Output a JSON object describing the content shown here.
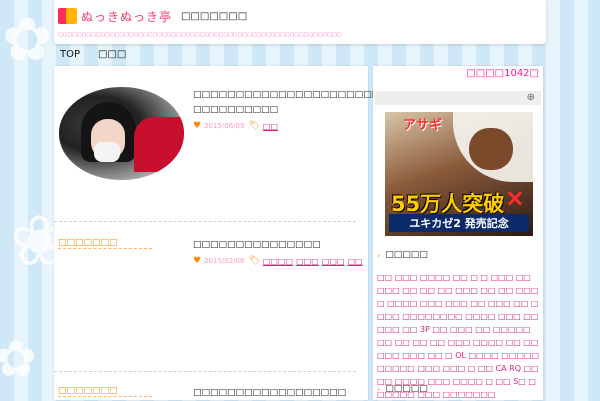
{
  "header": {
    "logo_text": "ぬっきぬっき亭",
    "site_title": "□□□□□□□",
    "tagline": "□□□□□□□□□□□□□□□□□□□□□□□□□□□□□□□□□□□□□□□□□□□□□□□□□□□□□□□□□□□□"
  },
  "nav": {
    "items": [
      "TOP",
      "□□□"
    ]
  },
  "posts": [
    {
      "title": "□□□□□□□□□□□□□□□□□□□□□□□□□□□□□□…□□□□□□□□□□",
      "date": "2015/06/09",
      "tags": [
        "□□"
      ]
    },
    {
      "category": "□□□□□□□",
      "title": "□□□□□□□□□□□□□□□",
      "date": "2015/02/06",
      "tags": [
        "□□□□",
        "□□□",
        "□□□",
        "□□"
      ]
    },
    {
      "category": "□□□□□□□",
      "title": "□□□□□□□□□□□□□□□□□□"
    }
  ],
  "sidebar": {
    "counter": "□□□□1042□",
    "banner": {
      "brand": "アサギ",
      "number": "55万人突破",
      "cross": "×",
      "subtitle": "ユキカゼ2 発売記念"
    },
    "tags_heading": "□□□□□",
    "tag_cloud": "□□ □□□ □□□□ □□ □ □ □□□ □□ □□□ □□ □□ □□ □□□ □□ □□ □□□□ □□□□ □□□ □□□ □□ □□□ □□ □□□□ □□□□□□□□ □□□□ □□□ □□ □□□ □□ 3P □□ □□□ □□ □□□□□ □□ □□ □□ □□ □□□ □□□□ □□ □□□□□ □□□ □□ □ OL □□□□ □□□□□ □□□□□ □□□ □□□ □ □□ CA RQ □□□□ □□□□ □□□ □□□□ □ □□ S□ □□□□□□ □□□ □□□□□□□",
    "bottom_heading": "□□□□□"
  }
}
